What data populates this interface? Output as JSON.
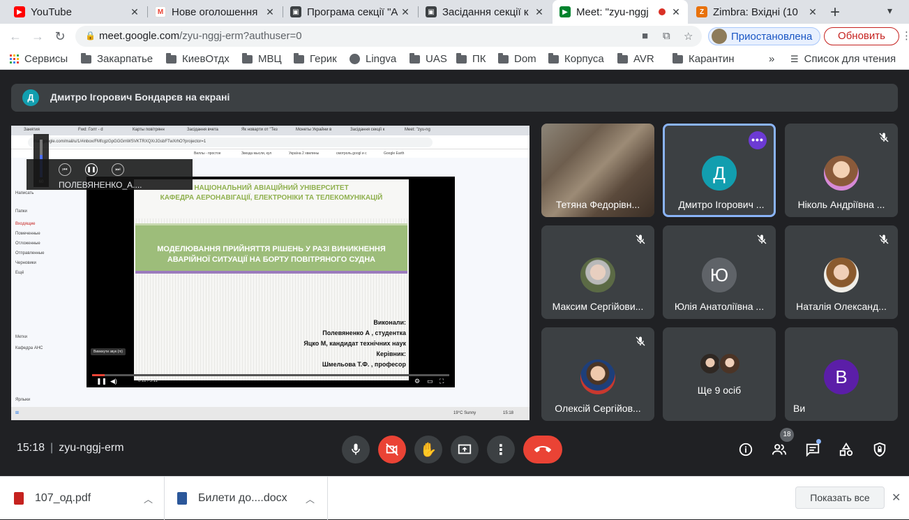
{
  "browser": {
    "tabs": [
      {
        "title": "YouTube",
        "icon": "youtube-icon"
      },
      {
        "title": "Нове оголошення",
        "icon": "gmail-icon"
      },
      {
        "title": "Програма секції \"А",
        "icon": "doc-icon"
      },
      {
        "title": "Засідання секції к",
        "icon": "doc-icon"
      },
      {
        "title": "Meet: \"zyu-nggj",
        "icon": "meet-icon",
        "active": true
      },
      {
        "title": "Zimbra: Вхідні (10",
        "icon": "zimbra-icon"
      }
    ],
    "url_host": "meet.google.com",
    "url_path": "/zyu-nggj-erm?authuser=0",
    "profile_label": "Приостановлена",
    "update_label": "Обновить",
    "bookmarks": [
      "Сервисы",
      "Закарпатье",
      "КиевОтдх",
      "МВЦ",
      "Герик",
      "Lingva",
      "UAS",
      "ПК",
      "Dom",
      "Корпуса",
      "AVR",
      "Карантин"
    ],
    "reading_list": "Список для чтения",
    "more_bookmarks": "»"
  },
  "meet": {
    "presenter_initial": "Д",
    "presenter_text": "Дмитро Ігорович Бондарєв на екрані",
    "shared_screen": {
      "mini_tabs": [
        "Занятия",
        "Fwd: Голт - d",
        "Карты повітрянн",
        "Засідання вчета",
        "Як новарти от \"Тез",
        "Монеты Украйни в",
        "Засідання секції к",
        "Meet: \"zyu-ng"
      ],
      "mini_url": "mail.google.com/mail/u/1/#inbox/FMfcgzGpGGGmWSVKTRXQXrJGsbFTwXrhO?projector=1",
      "mini_bookmarks": [
        "Виллы - простое",
        "Звезда мысли, кул",
        "Україна 2 хвилины",
        "смотроль.googl и с",
        "Google Earth"
      ],
      "gmail_sidebar": [
        "Написать",
        "Папки",
        "Входящие",
        "Помеченные",
        "Отложенные",
        "Отправленные",
        "Черновики",
        "Ещё",
        "Метки",
        "Кафедра АНС",
        "Ярлыки"
      ],
      "slide_header": [
        "НАЦІОНАЛЬНИЙ АВІАЦІЙНИЙ УНІВЕРСИТЕТ",
        "КАФЕДРА  АЕРОНАВІГАЦІЇ, ЕЛЕКТРОНІКИ  ТА ТЕЛЕКОМУНІКАЦІЙ"
      ],
      "slide_title": [
        "МОДЕЛЮВАННЯ ПРИЙНЯТТЯ РІШЕНЬ У РАЗІ ВИНИКНЕННЯ",
        "АВАРІЙНОЇ СИТУАЦІЇ НА БОРТУ ПОВІТРЯНОГО СУДНА"
      ],
      "slide_credits": [
        "Виконали:",
        "Полевяненко А , студентка",
        "Яцко М, кандидат технічних наук",
        "Керівник:",
        "Шмельова Т.Ф. , професор"
      ],
      "player_time": "0:12 / 5:11",
      "player_progress": 0.036,
      "mute_tooltip": "Вимкнути звук (m)",
      "taskbar_weather": "19°C  Sunny",
      "taskbar_clock": "15:18"
    },
    "overlay": {
      "file_name": "ПОЛЕВЯНЕНКО_А....",
      "volume_value": "60",
      "volume_level": 0.6
    },
    "tiles": [
      {
        "name": "Тетяна Федорівн...",
        "type": "camera"
      },
      {
        "name": "Дмитро Ігорович ...",
        "type": "letter",
        "letter": "Д",
        "color": "#129eaf",
        "active": true
      },
      {
        "name": "Ніколь Андріївна ...",
        "type": "photo",
        "muted": true
      },
      {
        "name": "Максим Сергійови...",
        "type": "photo",
        "muted": true
      },
      {
        "name": "Юлія Анатоліївна ...",
        "type": "letter",
        "letter": "Ю",
        "color": "#5f6368",
        "muted": true
      },
      {
        "name": "Наталія Олександ...",
        "type": "photo",
        "muted": true
      },
      {
        "name": "Олексій Сергійов...",
        "type": "photo",
        "muted": true
      },
      {
        "name": "Ще 9 осіб",
        "type": "group"
      },
      {
        "name": "Ви",
        "type": "letter",
        "letter": "В",
        "color": "#5b1ea8"
      }
    ],
    "time": "15:18",
    "meeting_code": "zyu-nggj-erm",
    "participants_count": "18"
  },
  "downloads": [
    {
      "name": "107_од.pdf",
      "icon": "pdf-file-icon"
    },
    {
      "name": "Билети до....docx",
      "icon": "word-file-icon"
    }
  ],
  "show_all_label": "Показать все",
  "colors": {
    "accent_blue": "#8ab4f8",
    "hangup_red": "#ea4335",
    "meet_bg": "#202124",
    "tile_bg": "#3c4043"
  }
}
